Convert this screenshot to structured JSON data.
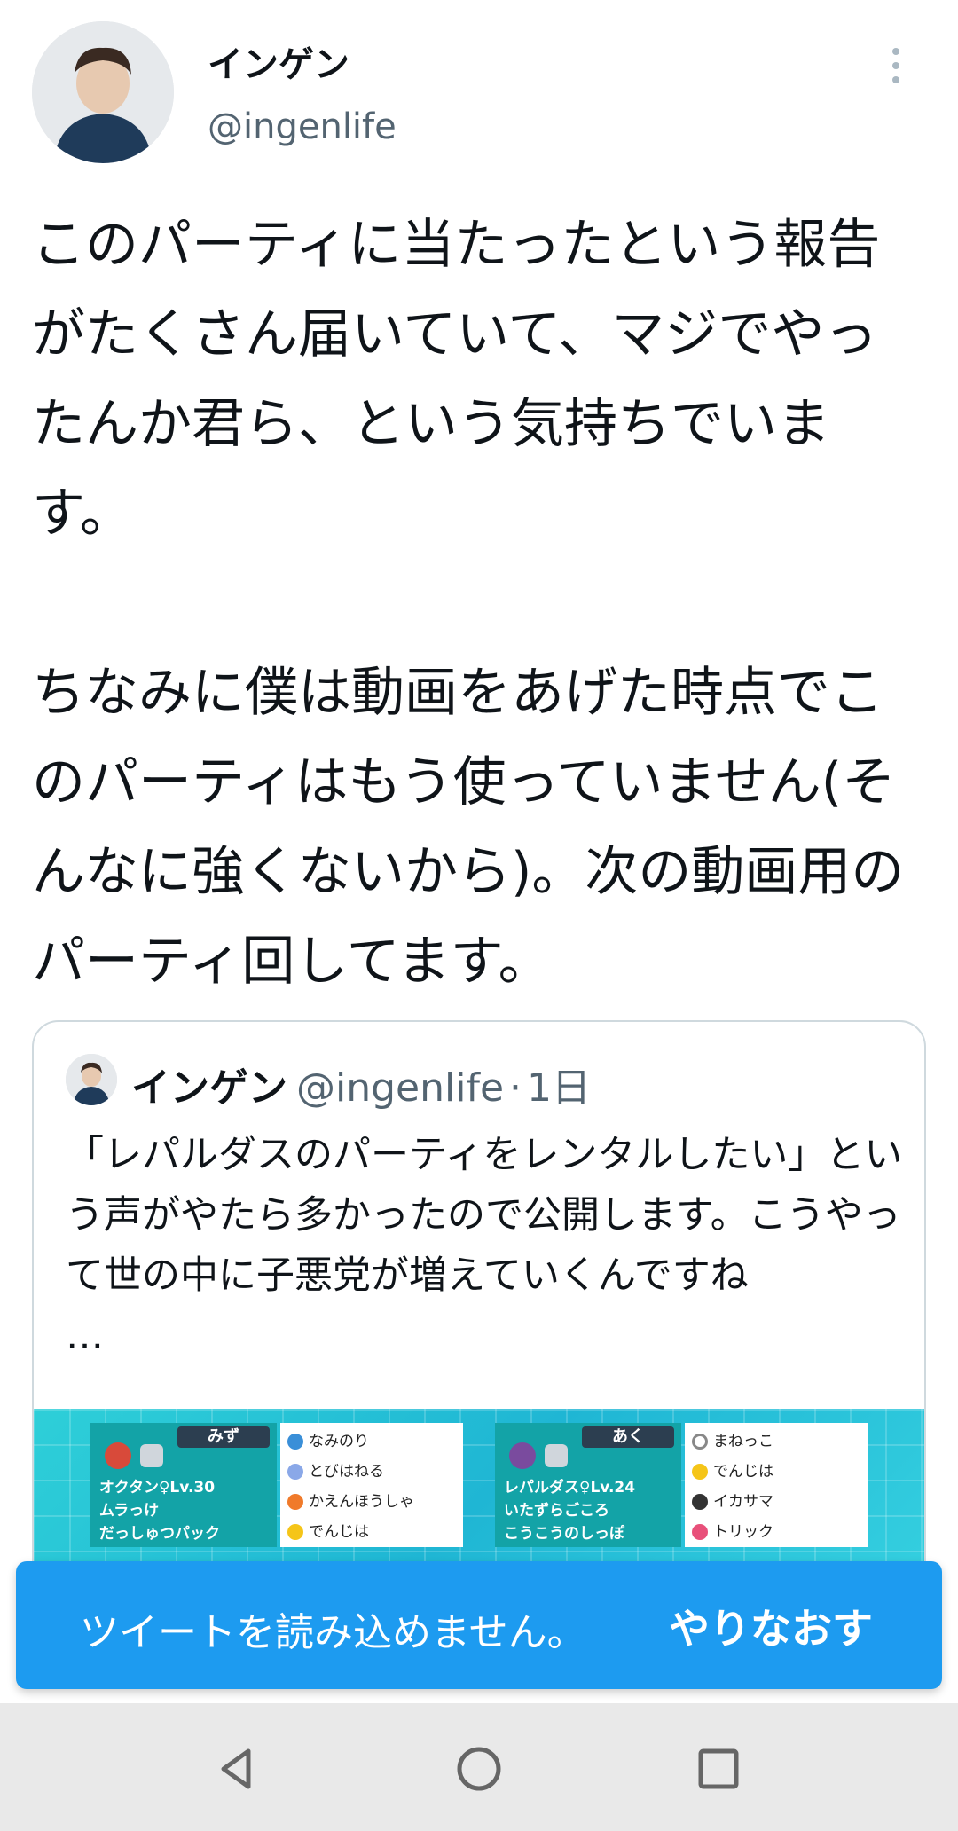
{
  "author": {
    "name": "インゲン",
    "handle": "@ingenlife"
  },
  "tweet": {
    "text": "このパーティに当たったという報告がたくさん届いていて、マジでやったんか君ら、という気持ちでいます。\n\nちなみに僕は動画をあげた時点でこのパーティはもう使っていません(そんなに強くないから)。次の動画用のパーティ回してます。"
  },
  "quoted": {
    "name": "インゲン",
    "handle": "@ingenlife",
    "dot": "·",
    "time": "1日",
    "text": "「レパルダスのパーティをレンタルしたい」という声がやたら多かったので公開します。こうやって世の中に子悪党が増えていくんですね",
    "ellipsis": "…",
    "image": {
      "panel1": {
        "type": "みず",
        "info": "オクタン♀Lv.30\nムラっけ\nだっしゅつパック",
        "moves": [
          "なみのり",
          "とびはねる",
          "かえんほうしゃ",
          "でんじは"
        ]
      },
      "panel2": {
        "type": "あく",
        "info": "レパルダス♀Lv.24\nいたずらごころ\nこうこうのしっぽ",
        "moves": [
          "まねっこ",
          "でんじは",
          "イカサマ",
          "トリック"
        ]
      }
    }
  },
  "toast": {
    "message": "ツイートを読み込めません。",
    "retry": "やりなおす"
  },
  "colors": {
    "accent": "#1d9bf0",
    "text": "#0f1419",
    "secondary": "#536471"
  }
}
